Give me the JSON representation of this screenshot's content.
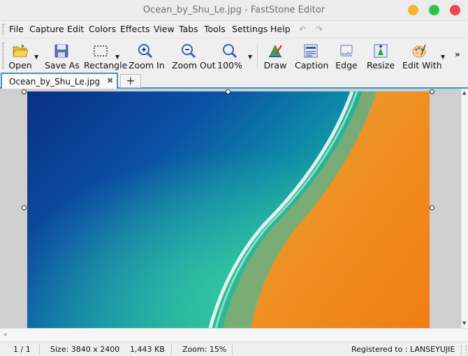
{
  "window": {
    "title": "Ocean_by_Shu_Le.jpg - FastStone Editor"
  },
  "menu": {
    "file": "File",
    "capture": "Capture",
    "edit": "Edit",
    "colors": "Colors",
    "effects": "Effects",
    "view": "View",
    "tabs": "Tabs",
    "tools": "Tools",
    "settings": "Settings",
    "help": "Help"
  },
  "toolbar": {
    "open": "Open",
    "save_as": "Save As",
    "rectangle": "Rectangle",
    "zoom_in": "Zoom In",
    "zoom_out": "Zoom Out",
    "zoom_100": "100%",
    "draw": "Draw",
    "caption": "Caption",
    "edge": "Edge",
    "resize": "Resize",
    "edit_with": "Edit With",
    "more": "»"
  },
  "tabs": [
    {
      "label": "Ocean_by_Shu_Le.jpg",
      "close": "✖"
    }
  ],
  "tab_add": "+",
  "status": {
    "page": "1 / 1",
    "size": "Size: 3840 x 2400",
    "filesize": "1,443 KB",
    "zoom": "Zoom: 15%",
    "registered": "Registered to : LANSEYUJIE"
  },
  "colors": {
    "accent": "#2f9ad6",
    "ocean_deep": "#0b3b8c",
    "ocean_shallow": "#1fae8e",
    "sand": "#e98a1e"
  },
  "icons": {
    "open": "folder-open-icon",
    "save_as": "floppy-disk-icon",
    "rectangle": "selection-rectangle-icon",
    "zoom_in": "zoom-in-icon",
    "zoom_out": "zoom-out-icon",
    "zoom_100": "magnifier-icon",
    "draw": "draw-icon",
    "caption": "caption-icon",
    "edge": "edge-icon",
    "resize": "resize-icon",
    "edit_with": "palette-icon"
  }
}
